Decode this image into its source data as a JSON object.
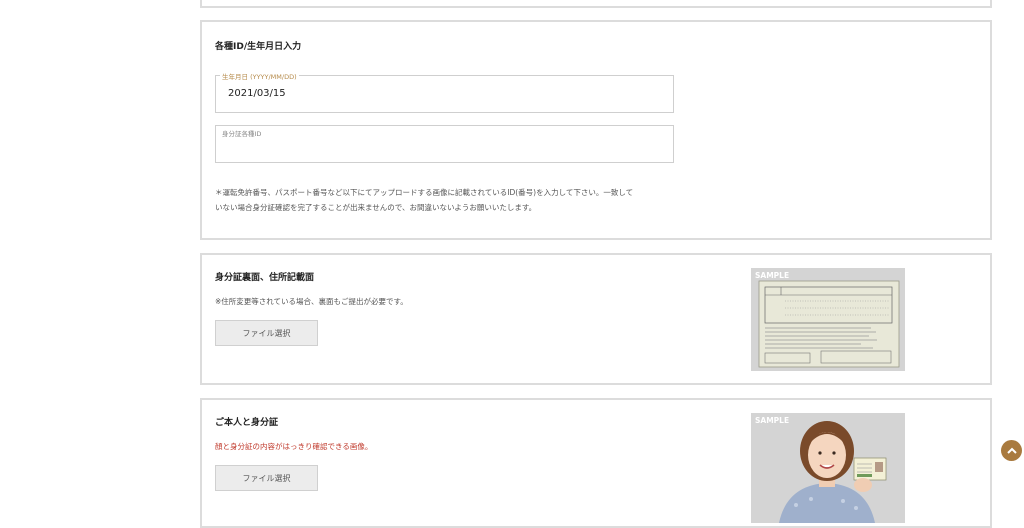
{
  "id_section": {
    "title": "各種ID/生年月日入力",
    "birthdate_label": "生年月日 (YYYY/MM/DD)",
    "birthdate_value": "2021/03/15",
    "id_label": "身分証各種ID",
    "id_value": "",
    "note_line1": "＊運転免許番号、パスポート番号など以下にてアップロードする画像に記載されているID(番号)を入力して下さい。一致して",
    "note_line2": "いない場合身分証確認を完了することが出来ませんので、お間違いないようお願いいたします。"
  },
  "back_section": {
    "title": "身分証裏面、住所記載面",
    "note": "※住所変更等されている場合、裏面もご提出が必要です。",
    "file_button": "ファイル選択",
    "sample_tag": "SAMPLE",
    "card_heading": "備 考"
  },
  "selfie_section": {
    "title": "ご本人と身分証",
    "note": "顔と身分証の内容がはっきり確認できる画像。",
    "file_button": "ファイル選択",
    "sample_tag": "SAMPLE"
  },
  "colors": {
    "accent": "#a97a3f",
    "warning_text": "#c0392b",
    "label_gold": "#b58a4a"
  },
  "icons": {
    "scroll_top": "chevron-up-icon"
  }
}
